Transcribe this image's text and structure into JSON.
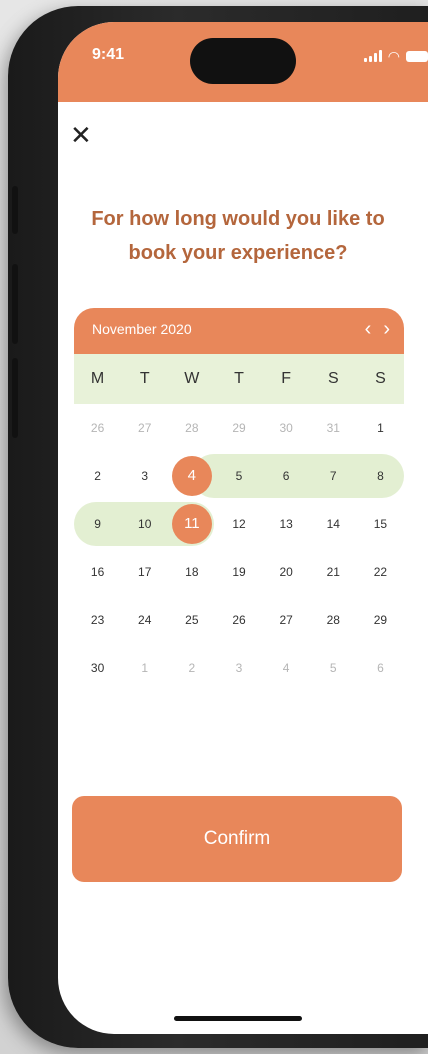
{
  "status_bar": {
    "time": "9:41"
  },
  "header": {
    "close_icon": "close-icon",
    "close_glyph": "✕"
  },
  "title": {
    "line1": "For how long would you like to",
    "line2": "book your experience?"
  },
  "calendar": {
    "month_label": "November 2020",
    "prev_glyph": "‹",
    "next_glyph": "›",
    "weekdays": [
      "M",
      "T",
      "W",
      "T",
      "F",
      "S",
      "S"
    ],
    "weeks": [
      [
        "26",
        "27",
        "28",
        "29",
        "30",
        "31",
        "1"
      ],
      [
        "2",
        "3",
        "4",
        "5",
        "6",
        "7",
        "8"
      ],
      [
        "9",
        "10",
        "11",
        "12",
        "13",
        "14",
        "15"
      ],
      [
        "16",
        "17",
        "18",
        "19",
        "20",
        "21",
        "22"
      ],
      [
        "23",
        "24",
        "25",
        "26",
        "27",
        "28",
        "29"
      ],
      [
        "30",
        "1",
        "2",
        "3",
        "4",
        "5",
        "6"
      ]
    ],
    "range_start": "4",
    "range_end": "11"
  },
  "confirm": {
    "label": "Confirm"
  },
  "colors": {
    "accent": "#e8875a",
    "range_highlight": "#e3efd2",
    "heading_text": "#b4663c"
  }
}
